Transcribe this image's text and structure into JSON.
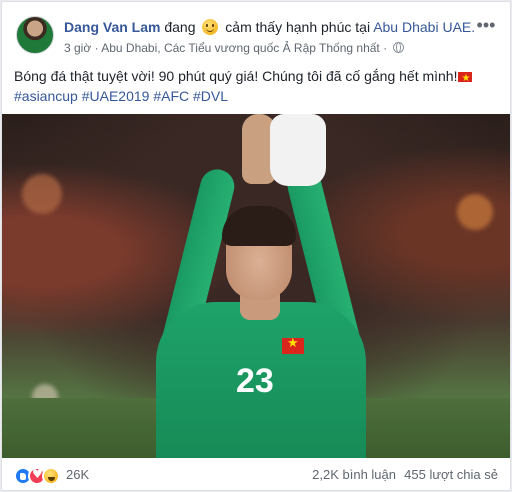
{
  "post": {
    "author": "Dang Van Lam",
    "feeling_prefix": "đang",
    "feeling_text": "cảm thấy hạnh phúc tại",
    "place": "Abu Dhabi UAE.",
    "time": "3 giờ",
    "location": "Abu Dhabi, Các Tiểu vương quốc Ả Rập Thống nhất",
    "privacy_icon": "globe-icon",
    "more_label": "•••",
    "text_line1": "Bóng đá thật tuyệt vời! 90 phút quý giá! Chúng tôi đã cố gắng hết mình!",
    "hashtags": [
      "#asiancup",
      "#UAE2019",
      "#AFC",
      "#DVL"
    ],
    "photo": {
      "jersey_number": "23"
    }
  },
  "footer": {
    "reactions": [
      "like-icon",
      "love-icon",
      "haha-icon"
    ],
    "reaction_count": "26K",
    "comments": "2,2K bình luận",
    "shares": "455 lượt chia sẻ"
  },
  "colors": {
    "link": "#365899",
    "muted": "#606770",
    "jersey": "#1ea36a",
    "flag_red": "#da251d",
    "flag_star": "#ffde00"
  }
}
